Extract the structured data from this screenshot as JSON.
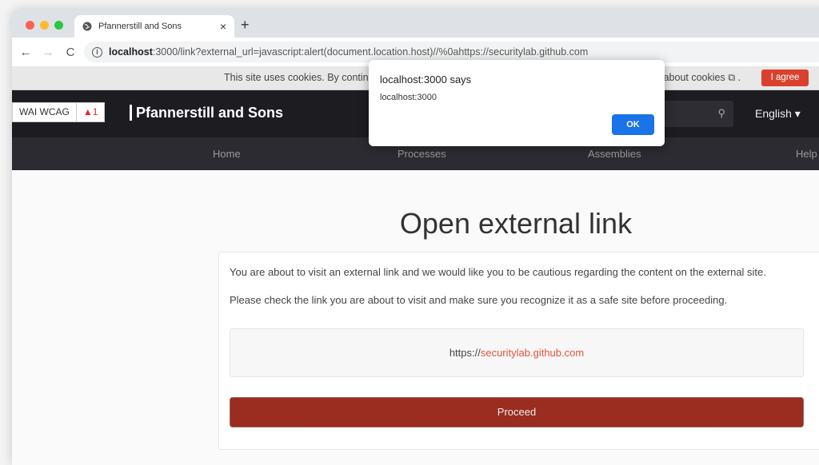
{
  "browser": {
    "tab_title": "Pfannerstill and Sons",
    "tab_close": "×",
    "new_tab": "+",
    "back": "←",
    "forward": "→",
    "reload": "C",
    "url_host": "localhost",
    "url_rest": ":3000/link?external_url=javascript:alert(document.location.host)//%0ahttps://securitylab.github.com"
  },
  "cookie_banner": {
    "text_start": "This site uses cookies. By continu",
    "text_end": "re about cookies ⧉ .",
    "agree_label": "I agree"
  },
  "header": {
    "wcag_label": "WAI WCAG",
    "wcag_warning_count": "1",
    "brand": "Pfannerstill and Sons",
    "language": "English ▾"
  },
  "nav": {
    "items": [
      "Home",
      "Processes",
      "Assemblies",
      "Help"
    ]
  },
  "main": {
    "title": "Open external link",
    "paragraph1": "You are about to visit an external link and we would like you to be cautious regarding the content on the external site.",
    "paragraph2": "Please check the link you are about to visit and make sure you recognize it as a safe site before proceeding.",
    "link_scheme": "https://",
    "link_domain": "securitylab.github.com",
    "proceed_label": "Proceed"
  },
  "alert": {
    "title": "localhost:3000 says",
    "message": "localhost:3000",
    "ok_label": "OK"
  },
  "colors": {
    "accent_red": "#9a2c20",
    "agree_red": "#d9412e",
    "link_color": "#e0553d",
    "ok_blue": "#1a73e8",
    "header_bg": "#1d1c21"
  }
}
